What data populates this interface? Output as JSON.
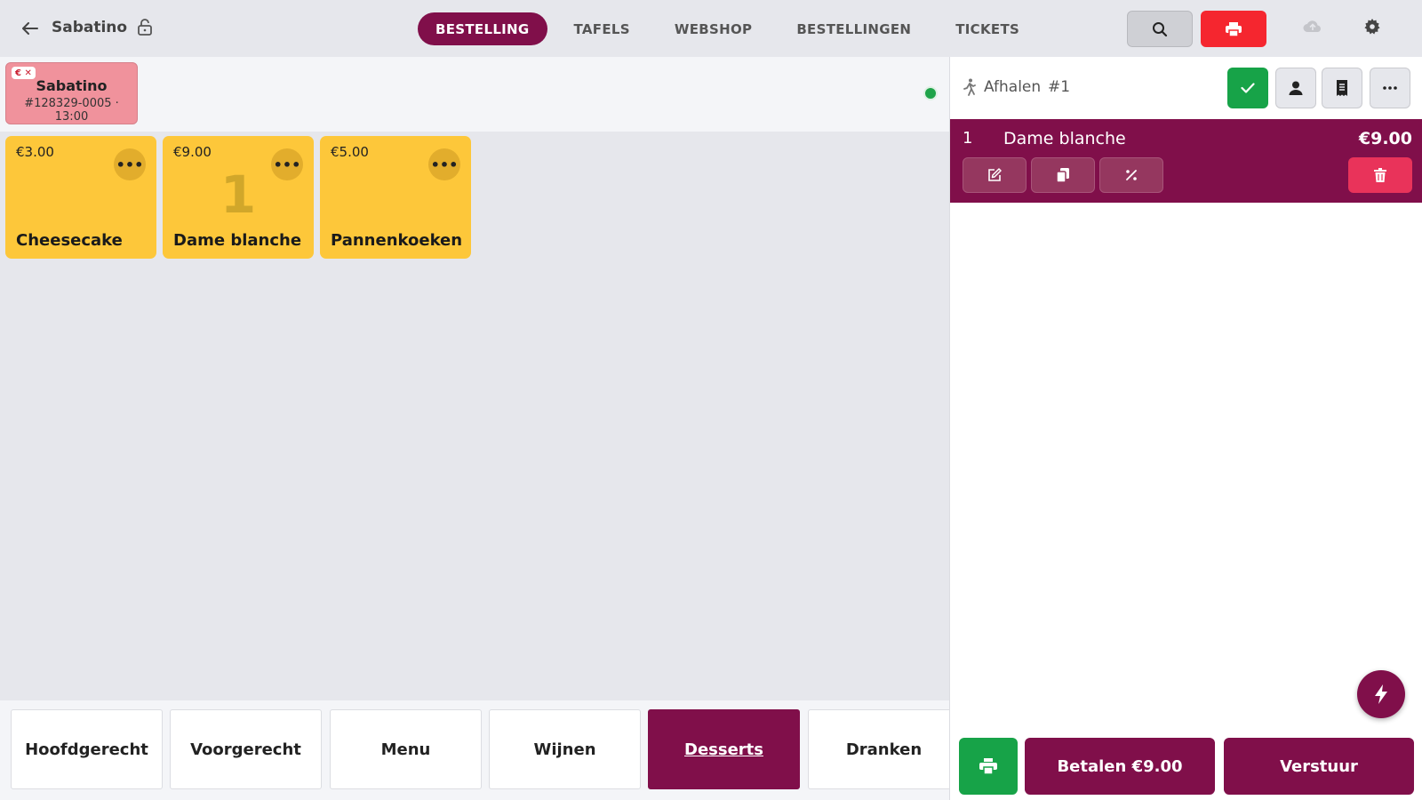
{
  "app": {
    "title": "Sabatino"
  },
  "nav": {
    "tabs": [
      {
        "label": "BESTELLING",
        "active": true
      },
      {
        "label": "TAFELS"
      },
      {
        "label": "WEBSHOP"
      },
      {
        "label": "BESTELLINGEN"
      },
      {
        "label": "TICKETS"
      }
    ]
  },
  "order_card": {
    "badge": "€ ✕",
    "name": "Sabatino",
    "meta": "#128329-0005 · 13:00"
  },
  "products": [
    {
      "price": "€3.00",
      "name": "Cheesecake",
      "qty": ""
    },
    {
      "price": "€9.00",
      "name": "Dame blanche",
      "qty": "1"
    },
    {
      "price": "€5.00",
      "name": "Pannenkoeken",
      "qty": ""
    }
  ],
  "categories": [
    {
      "label": "Hoofdgerecht"
    },
    {
      "label": "Voorgerecht"
    },
    {
      "label": "Menu"
    },
    {
      "label": "Wijnen"
    },
    {
      "label": "Desserts",
      "active": true
    },
    {
      "label": "Dranken"
    }
  ],
  "panel": {
    "order_type": "Afhalen",
    "order_number": "#1",
    "lines": [
      {
        "qty": "1",
        "name": "Dame blanche",
        "price": "€9.00"
      }
    ],
    "pay_label": "Betalen €9.00",
    "send_label": "Verstuur"
  },
  "colors": {
    "brand": "#800f4a",
    "success": "#17a348",
    "danger": "#f5262f",
    "product": "#fdc73a"
  }
}
